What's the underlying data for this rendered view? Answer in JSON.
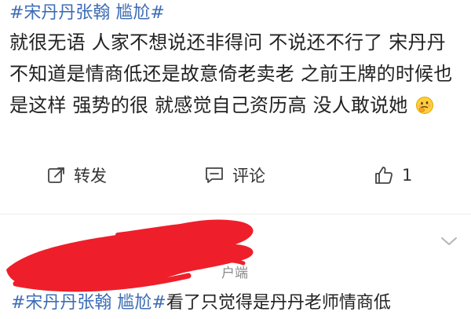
{
  "post": {
    "hashtags": [
      "#宋丹丹张翰 尴尬#"
    ],
    "text": "就很无语 人家不想说还非得问 不说还不行了 宋丹丹不知道是情商低还是故意倚老卖老 之前王牌的时候也是这样 强势的很 就感觉自己资历高 没人敢说她",
    "emoji": "thinking-face-emoji"
  },
  "actions": {
    "repost_label": "转发",
    "comment_label": "评论",
    "like_count": "1"
  },
  "next_post": {
    "meta_fragment": "户端",
    "hashtag": "#宋丹丹张翰 尴尬#",
    "text": "看了只觉得是丹丹老师情商低"
  },
  "colors": {
    "link": "#3d6db5",
    "text": "#222222",
    "redaction": "#ee1f2a"
  },
  "icons": {
    "repost": "share-icon",
    "comment": "comment-icon",
    "like": "thumbs-up-icon",
    "collapse": "chevron-down-icon"
  }
}
